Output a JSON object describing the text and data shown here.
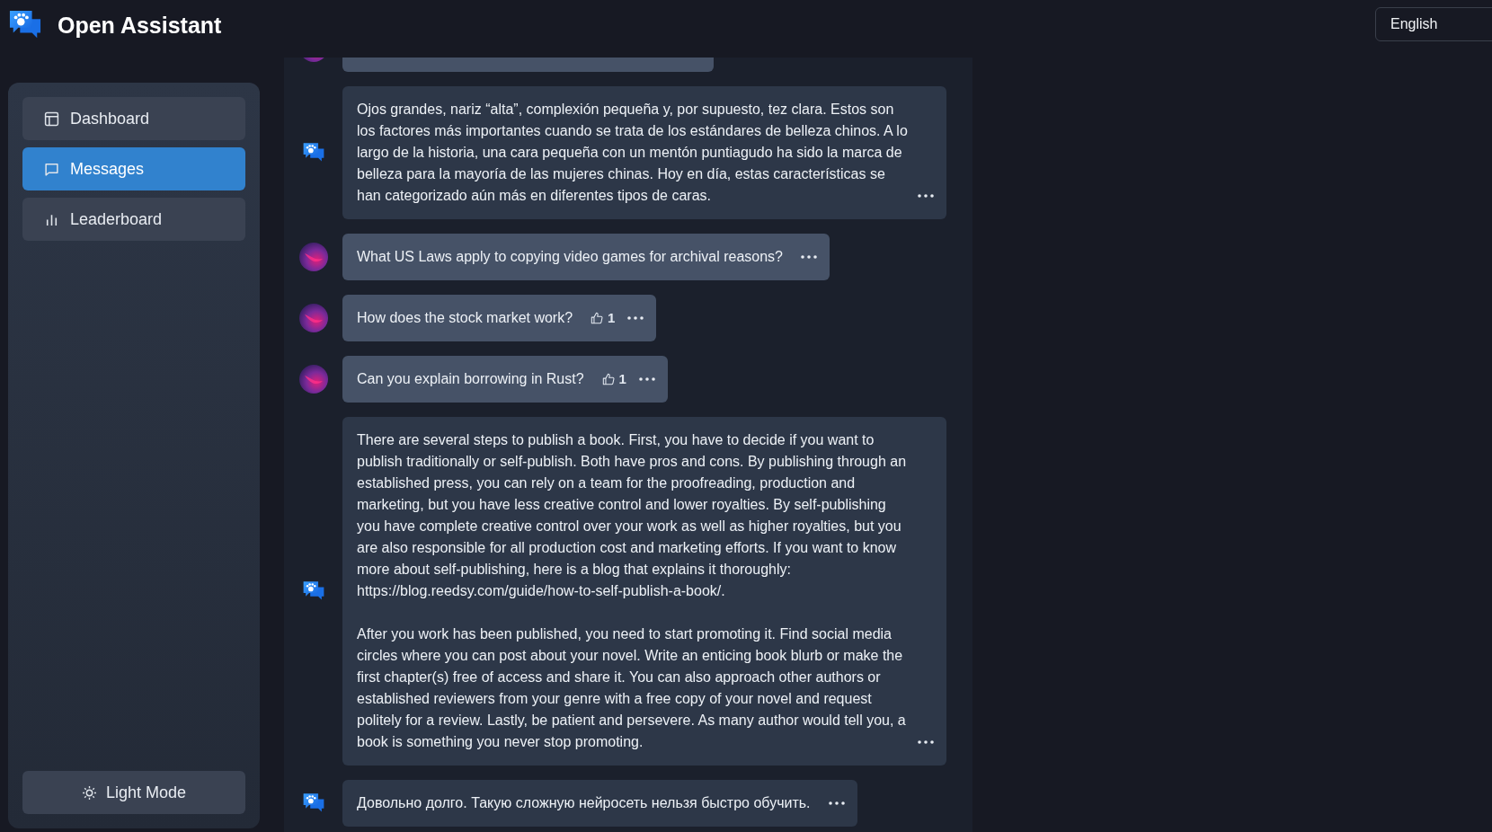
{
  "app": {
    "title": "Open Assistant"
  },
  "language_select": {
    "value": "English"
  },
  "sidebar": {
    "items": [
      {
        "label": "Dashboard",
        "selected": false
      },
      {
        "label": "Messages",
        "selected": true
      },
      {
        "label": "Leaderboard",
        "selected": false
      }
    ],
    "theme_toggle": {
      "label": "Light Mode"
    }
  },
  "messages": [
    {
      "kind": "user"
    },
    {
      "kind": "assistant",
      "paragraphs": [
        "Ojos grandes, nariz “alta”, complexión pequeña y, por supuesto, tez clara. Estos son los factores más importantes cuando se trata de los estándares de belleza chinos. A lo largo de la historia, una cara pequeña con un mentón puntiagudo ha sido la marca de belleza para la mayoría de las mujeres chinas. Hoy en día, estas características se han categorizado aún más en diferentes tipos de caras."
      ]
    },
    {
      "kind": "user",
      "paragraphs": [
        "What US Laws apply to copying video games for archival reasons?"
      ]
    },
    {
      "kind": "user",
      "paragraphs": [
        "How does the stock market work?"
      ],
      "likes": "1"
    },
    {
      "kind": "user",
      "paragraphs": [
        "Can you explain borrowing in Rust?"
      ],
      "likes": "1"
    },
    {
      "kind": "assistant",
      "paragraphs": [
        "There are several steps to publish a book. First, you have to decide if you want to publish traditionally or self-publish. Both have pros and cons. By publishing through an established press, you can rely on a team for the proofreading, production and marketing, but you have less creative control and lower royalties. By self-publishing you have complete creative control over your work as well as higher royalties, but you are also responsible for all production cost and marketing efforts. If you want to know more about self-publishing, here is a blog that explains it thoroughly: https://blog.reedsy.com/guide/how-to-self-publish-a-book/.",
        "After you work has been published, you need to start promoting it. Find social media circles where you can post about your novel. Write an enticing book blurb or make the first chapter(s) free of access and share it. You can also approach other authors or established reviewers from your genre with a free copy of your novel and request politely for a review. Lastly, be patient and persevere. As many author would tell you, a book is something you never stop promoting."
      ]
    },
    {
      "kind": "assistant",
      "paragraphs": [
        "Довольно долго. Такую сложную нейросеть нельзя быстро обучить."
      ]
    }
  ]
}
